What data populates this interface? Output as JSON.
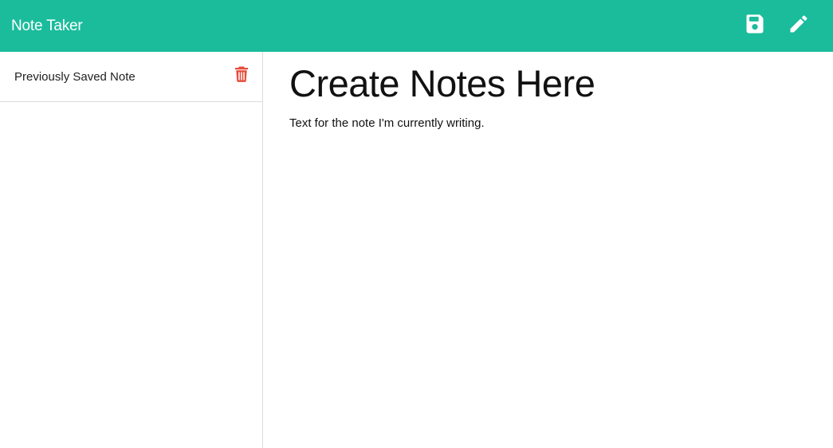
{
  "app": {
    "title": "Note Taker"
  },
  "toolbar": {
    "save_icon": "save-icon",
    "new_icon": "pencil-icon"
  },
  "sidebar": {
    "notes": [
      {
        "title": "Previously Saved Note",
        "delete_icon": "trash-icon"
      }
    ]
  },
  "editor": {
    "title_value": "Create Notes Here",
    "text_value": "Text for the note I'm currently writing."
  },
  "colors": {
    "navbar": "#1abc9c",
    "delete": "#e74c3c",
    "text": "#111111"
  }
}
